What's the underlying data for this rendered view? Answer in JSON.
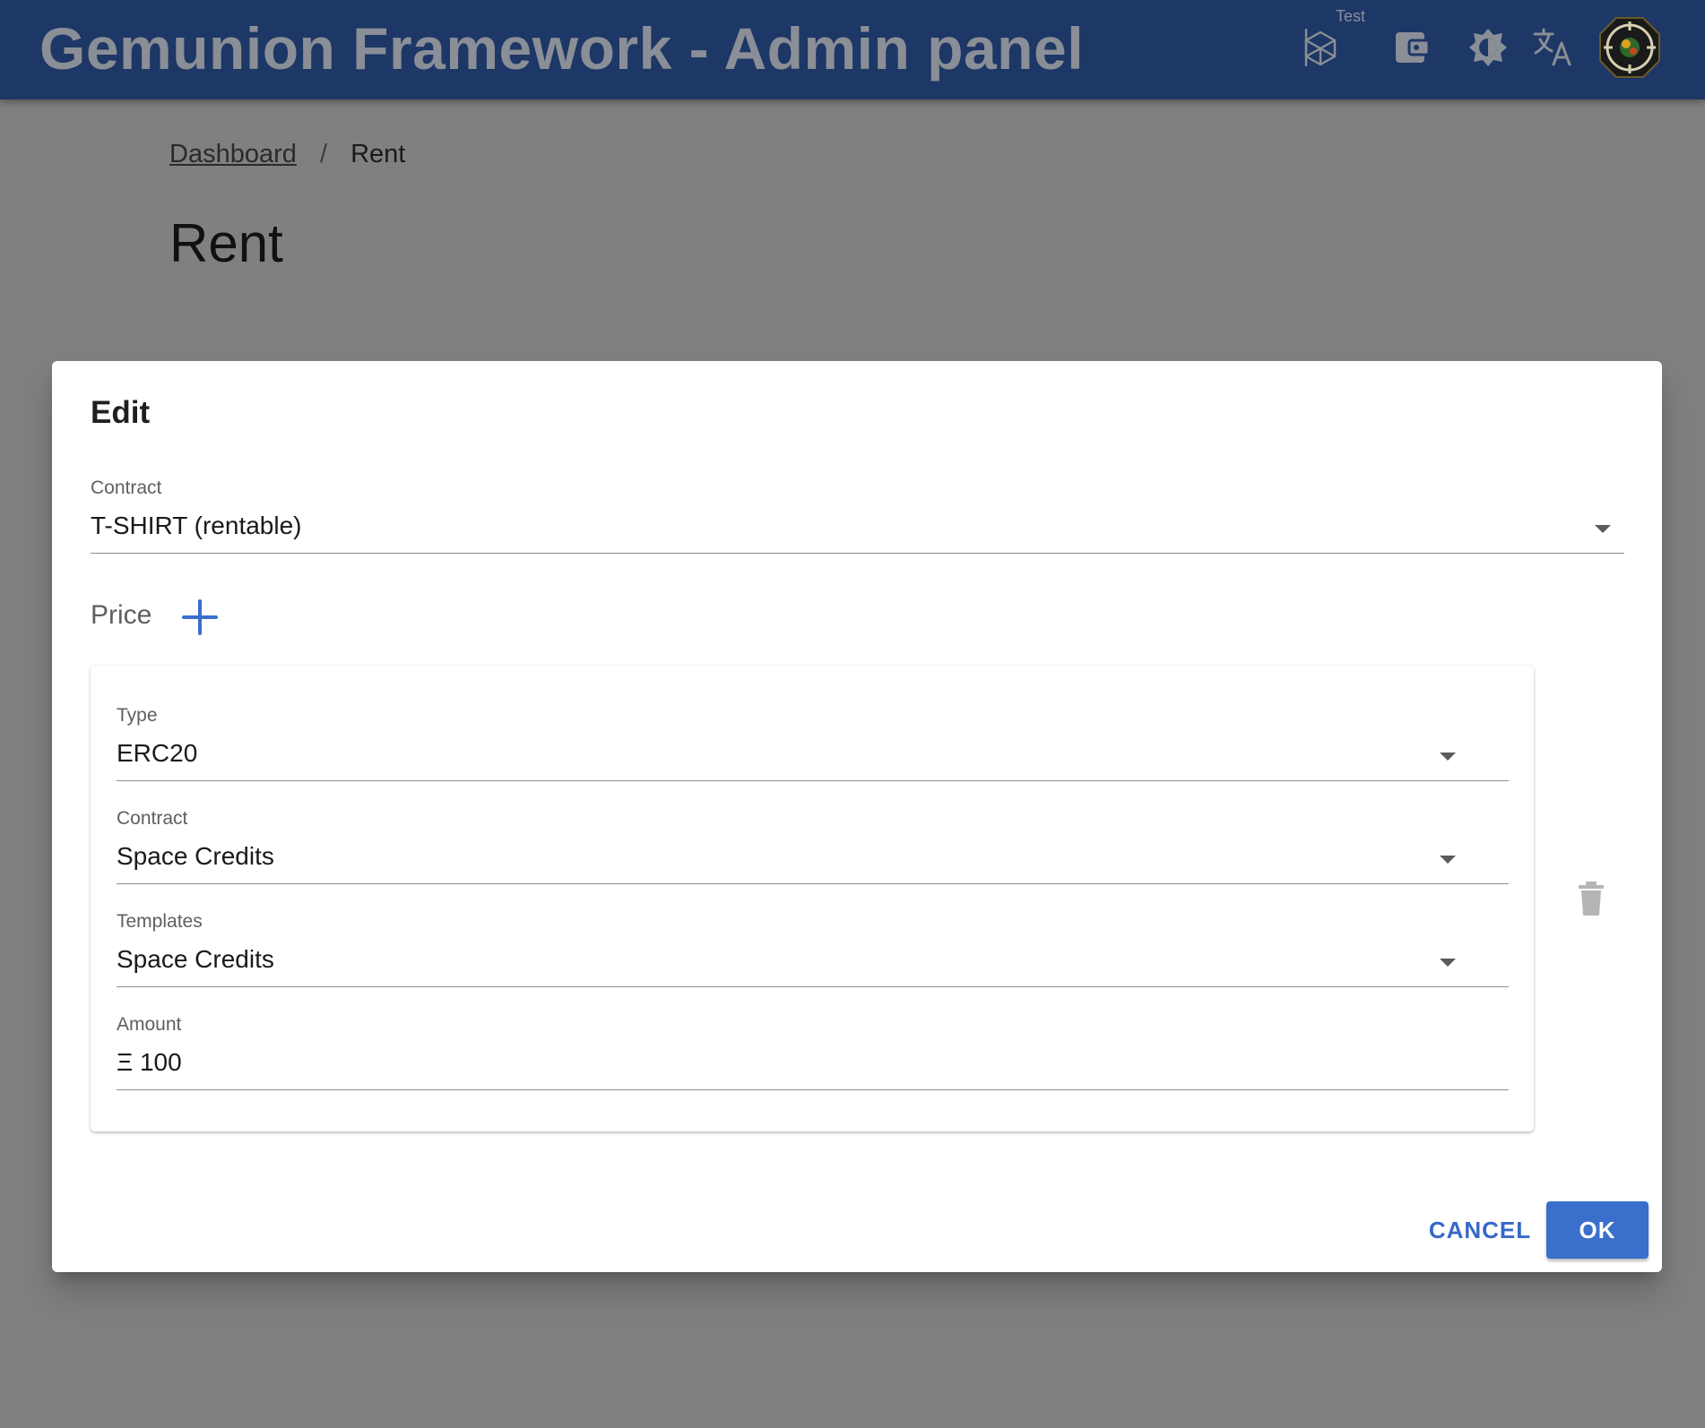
{
  "app": {
    "title": "Gemunion Framework - Admin panel",
    "network_label": "Test"
  },
  "header_icons": [
    "network-icon",
    "wallet-icon",
    "theme-icon",
    "language-icon",
    "avatar"
  ],
  "breadcrumb": {
    "items": [
      "Dashboard",
      "Rent"
    ],
    "separator": "/"
  },
  "page": {
    "title": "Rent"
  },
  "dialog": {
    "title": "Edit",
    "contract": {
      "label": "Contract",
      "value": "T-SHIRT (rentable)"
    },
    "price": {
      "label": "Price",
      "items": [
        {
          "type": {
            "label": "Type",
            "value": "ERC20"
          },
          "contract": {
            "label": "Contract",
            "value": "Space Credits"
          },
          "templates": {
            "label": "Templates",
            "value": "Space Credits"
          },
          "amount": {
            "label": "Amount",
            "prefix": "Ξ",
            "value": "100"
          }
        }
      ]
    },
    "buttons": {
      "cancel": "CANCEL",
      "ok": "OK"
    }
  },
  "colors": {
    "appbar": "#1d3766",
    "accent": "#3a6fcc",
    "scrim": "#808080"
  }
}
